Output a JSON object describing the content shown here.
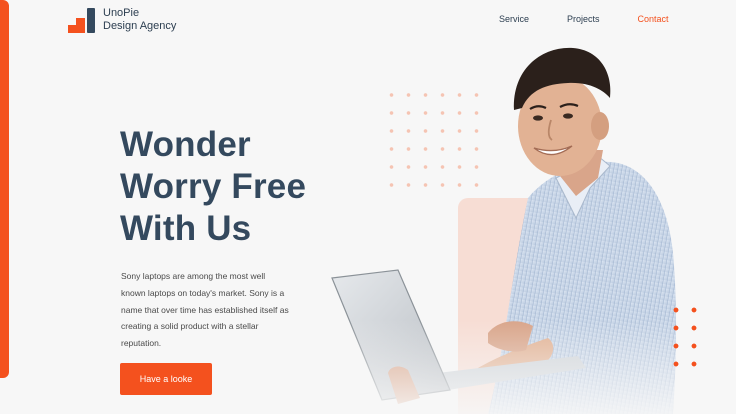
{
  "brand": {
    "line1": "UnoPie",
    "line2": "Design Agency",
    "accent_color": "#f4511e",
    "dark_color": "#34495e"
  },
  "nav": {
    "items": [
      {
        "label": "Service"
      },
      {
        "label": "Projects"
      },
      {
        "label": "Contact"
      }
    ],
    "active": "Contact"
  },
  "hero": {
    "title_lines": [
      "Wonder",
      "Worry Free",
      "With Us"
    ],
    "description": "Sony laptops are among the most well known laptops on today's market. Sony is a name that over time has established itself as creating a solid product with a stellar reputation.",
    "cta_label": "Have a looke"
  },
  "image": {
    "subject": "smiling man in striped shirt holding laptop"
  }
}
